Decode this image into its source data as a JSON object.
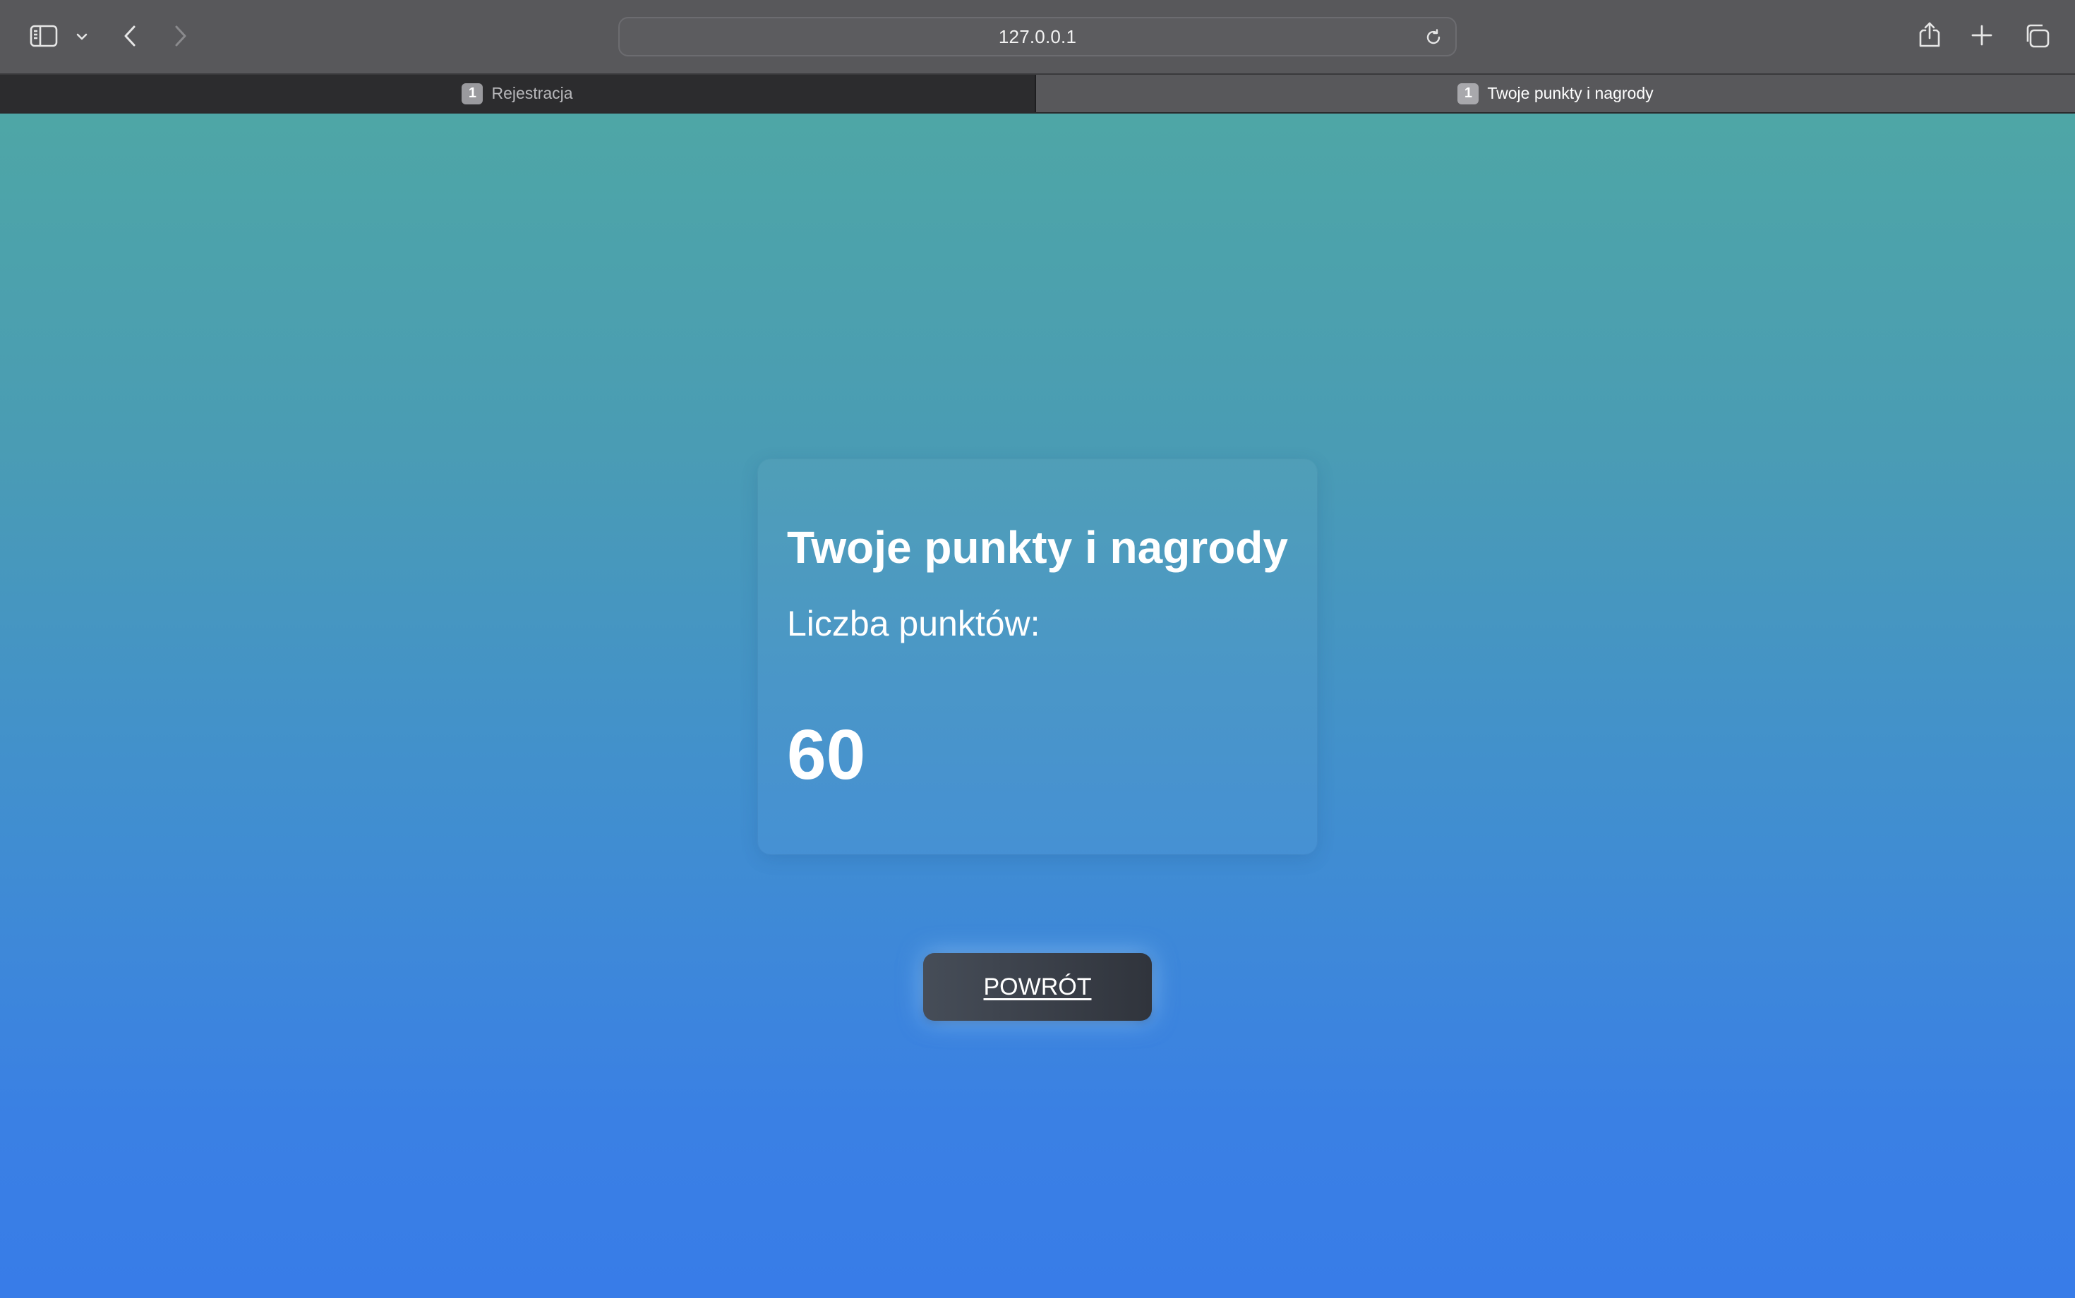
{
  "browser": {
    "address": "127.0.0.1",
    "icons": {
      "sidebar": "sidebar-icon",
      "sidebar_menu": "chevron-down-icon",
      "back": "chevron-left-icon",
      "forward": "chevron-right-icon",
      "reload": "reload-icon",
      "share": "share-icon",
      "new_tab": "plus-icon",
      "tab_overview": "tab-overview-icon"
    },
    "tabs": [
      {
        "badge": "1",
        "label": "Rejestracja",
        "active": false
      },
      {
        "badge": "1",
        "label": "Twoje punkty i nagrody",
        "active": true
      }
    ]
  },
  "page": {
    "title": "Twoje punkty i nagrody",
    "points_label": "Liczba punktów:",
    "points_value": "60",
    "back_button": "POWRÓT"
  },
  "colors": {
    "gradient_top": "#4ea6a6",
    "gradient_bottom": "#387ce8",
    "button_bg": "#3a3f48",
    "toolbar_bg": "#58585b"
  }
}
